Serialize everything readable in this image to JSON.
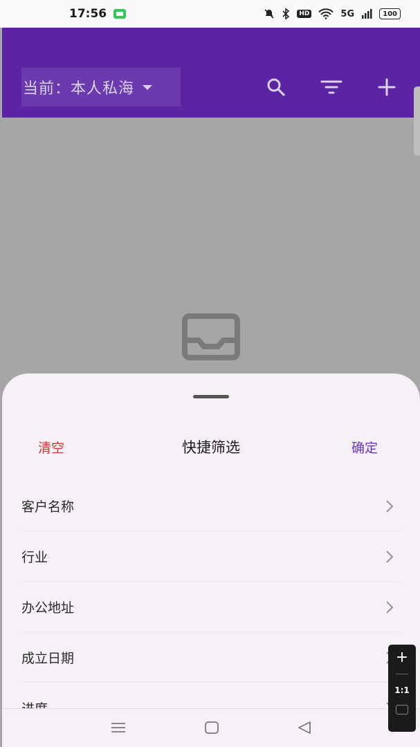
{
  "status_bar": {
    "time": "17:56",
    "network": "5G",
    "hd": "HD",
    "battery": "100"
  },
  "header": {
    "scope_label": "当前：本人私海",
    "icons": [
      "search-icon",
      "filter-icon",
      "add-icon"
    ]
  },
  "sheet": {
    "clear_label": "清空",
    "title": "快捷筛选",
    "confirm_label": "确定",
    "filters": [
      {
        "label": "客户名称"
      },
      {
        "label": "行业"
      },
      {
        "label": "办公地址"
      },
      {
        "label": "成立日期"
      },
      {
        "label": "进度"
      }
    ]
  },
  "zoom_widget": {
    "plus": "+",
    "ratio": "1:1"
  },
  "colors": {
    "app_bar": "#5a24a3",
    "clear": "#d0342c",
    "confirm": "#6a35c2",
    "sheet_bg": "#f6f0f7"
  }
}
